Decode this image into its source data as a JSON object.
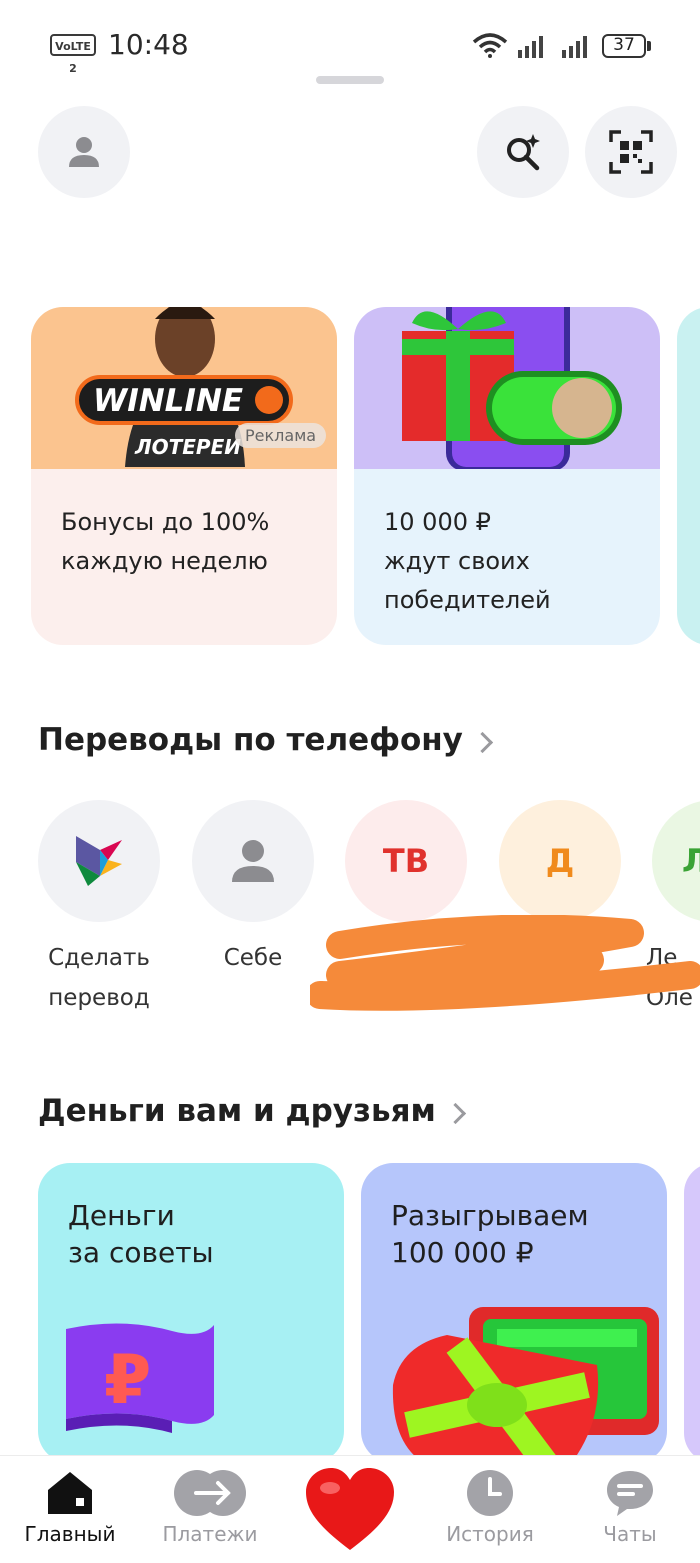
{
  "status_bar": {
    "network": "VoLTE 2",
    "time": "10:48",
    "battery": "37"
  },
  "promos": [
    {
      "brand": "WINLINE",
      "sub": "ЛОТЕРЕИ",
      "badge": "Реклама",
      "text": "Бонусы до 100%\nкаждую неделю",
      "bg": "#fcefed",
      "top_bg": "#fbc48f"
    },
    {
      "text": "10 000 ₽\nждут своих\nпобедителей",
      "bg": "#e6f3fc",
      "top_bg": "#cdbff7"
    }
  ],
  "transfers": {
    "title": "Переводы по телефону",
    "contacts": [
      {
        "initials": "",
        "label": "Сделать\nперевод",
        "bg": "#f1f2f5"
      },
      {
        "initials": "",
        "label": "Себе",
        "bg": "#f1f2f5"
      },
      {
        "initials": "ТВ",
        "label": "",
        "bg": "#fdecec",
        "color": "#e0322d"
      },
      {
        "initials": "Д",
        "label": "",
        "bg": "#fef0dd",
        "color": "#f08a1c"
      },
      {
        "initials": "Л",
        "label": "Ле\nОле",
        "bg": "#eaf7e3",
        "color": "#3aa335"
      }
    ]
  },
  "money": {
    "title": "Деньги вам и друзьям",
    "cards": [
      {
        "text": "Деньги\nза советы",
        "bg": "#a7f0f3"
      },
      {
        "text": "Разыгрываем\n100 000 ₽",
        "bg": "#b6c6fb"
      }
    ]
  },
  "nav": [
    {
      "label": "Главный",
      "active": true
    },
    {
      "label": "Платежи",
      "active": false
    },
    {
      "label": "",
      "active": false
    },
    {
      "label": "История",
      "active": false
    },
    {
      "label": "Чаты",
      "active": false
    }
  ]
}
